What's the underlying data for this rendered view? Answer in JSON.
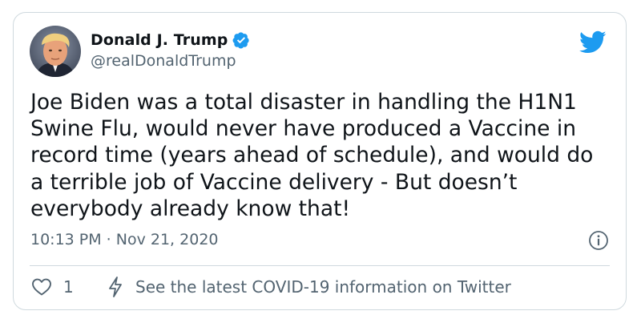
{
  "tweet": {
    "author_name": "Donald J. Trump",
    "handle": "@realDonaldTrump",
    "text": "Joe Biden was a total disaster in handling the H1N1\nSwine Flu, would never have produced a Vaccine in\nrecord time (years ahead of schedule), and would do\na terrible job of Vaccine delivery - But doesn’t\neverybody already know that!",
    "timestamp": "10:13 PM · Nov 21, 2020",
    "like_count": "1",
    "covid_link": "See the latest COVID-19 information on Twitter"
  },
  "icons": {
    "verified": "verified-badge-icon",
    "brand": "twitter-bird-icon",
    "info": "info-icon",
    "like": "heart-icon",
    "covid": "lightning-bolt-icon"
  },
  "colors": {
    "twitter_blue": "#1d9bf0",
    "text_primary": "#0f1419",
    "text_secondary": "#536471",
    "border": "#cfd9de"
  }
}
